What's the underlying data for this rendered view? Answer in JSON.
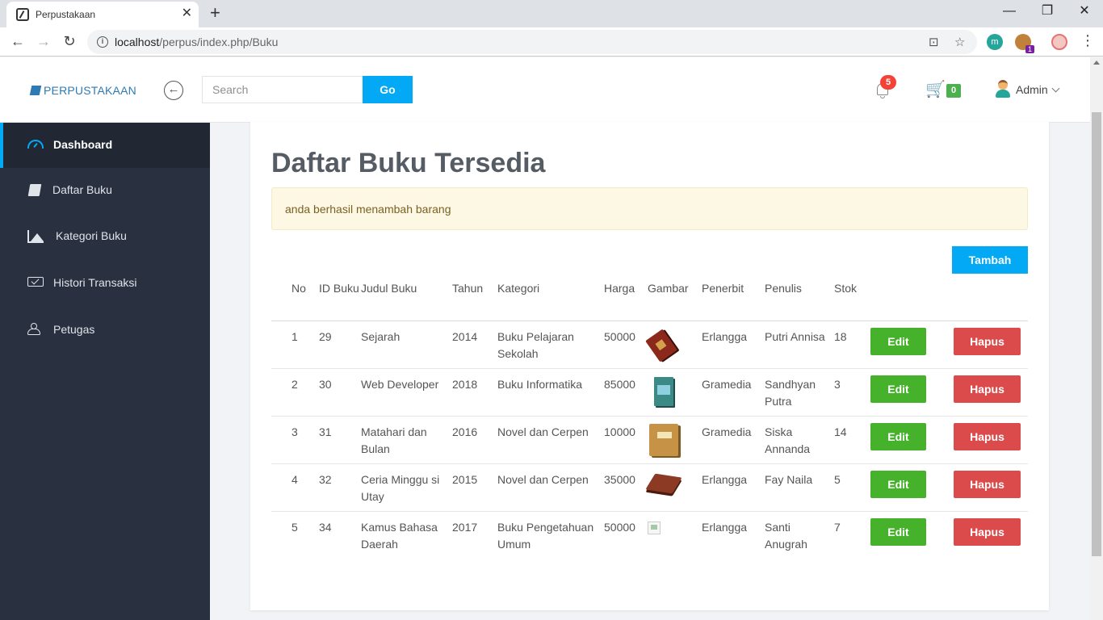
{
  "browser": {
    "tab_title": "Perpustakaan",
    "tab_close": "✕",
    "new_tab": "+",
    "url_host": "localhost",
    "url_path": "/perpus/index.php/Buku",
    "minimize": "—",
    "maximize": "❐",
    "close": "✕",
    "ext_m": "m",
    "ext_badge": "1"
  },
  "header": {
    "brand": "PERPUSTAKAAN",
    "search_placeholder": "Search",
    "go_label": "Go",
    "notif_count": "5",
    "cart_count": "0",
    "user_name": "Admin"
  },
  "sidebar": {
    "items": [
      {
        "label": "Dashboard",
        "icon": "dashboard-icon",
        "active": true
      },
      {
        "label": "Daftar Buku",
        "icon": "book-icon"
      },
      {
        "label": "Kategori Buku",
        "icon": "area-chart-icon"
      },
      {
        "label": "Histori Transaksi",
        "icon": "history-icon"
      },
      {
        "label": "Petugas",
        "icon": "users-icon"
      }
    ]
  },
  "main": {
    "title": "Daftar Buku Tersedia",
    "alert": "anda berhasil menambah barang",
    "add_button": "Tambah",
    "columns": [
      "No",
      "ID Buku",
      "Judul Buku",
      "Tahun",
      "Kategori",
      "Harga",
      "Gambar",
      "Penerbit",
      "Penulis",
      "Stok"
    ],
    "edit_label": "Edit",
    "delete_label": "Hapus",
    "rows": [
      {
        "no": "1",
        "id": "29",
        "judul": "Sejarah",
        "tahun": "2014",
        "kategori": "Buku Pelajaran Sekolah",
        "harga": "50000",
        "penerbit": "Erlangga",
        "penulis": "Putri Annisa",
        "stok": "18"
      },
      {
        "no": "2",
        "id": "30",
        "judul": "Web Developer",
        "tahun": "2018",
        "kategori": "Buku Informatika",
        "harga": "85000",
        "penerbit": "Gramedia",
        "penulis": "Sandhyan Putra",
        "stok": "3"
      },
      {
        "no": "3",
        "id": "31",
        "judul": "Matahari dan Bulan",
        "tahun": "2016",
        "kategori": "Novel dan Cerpen",
        "harga": "10000",
        "penerbit": "Gramedia",
        "penulis": "Siska Annanda",
        "stok": "14"
      },
      {
        "no": "4",
        "id": "32",
        "judul": "Ceria Minggu si Utay",
        "tahun": "2015",
        "kategori": "Novel dan Cerpen",
        "harga": "35000",
        "penerbit": "Erlangga",
        "penulis": "Fay Naila",
        "stok": "5"
      },
      {
        "no": "5",
        "id": "34",
        "judul": "Kamus Bahasa Daerah",
        "tahun": "2017",
        "kategori": "Buku Pengetahuan Umum",
        "harga": "50000",
        "penerbit": "Erlangga",
        "penulis": "Santi Anugrah",
        "stok": "7"
      }
    ]
  },
  "colors": {
    "accent": "#03a9f4",
    "sidebar_bg": "#293140",
    "edit": "#46b12a",
    "delete": "#dc4b4b",
    "alert_bg": "#fdf8e4"
  }
}
